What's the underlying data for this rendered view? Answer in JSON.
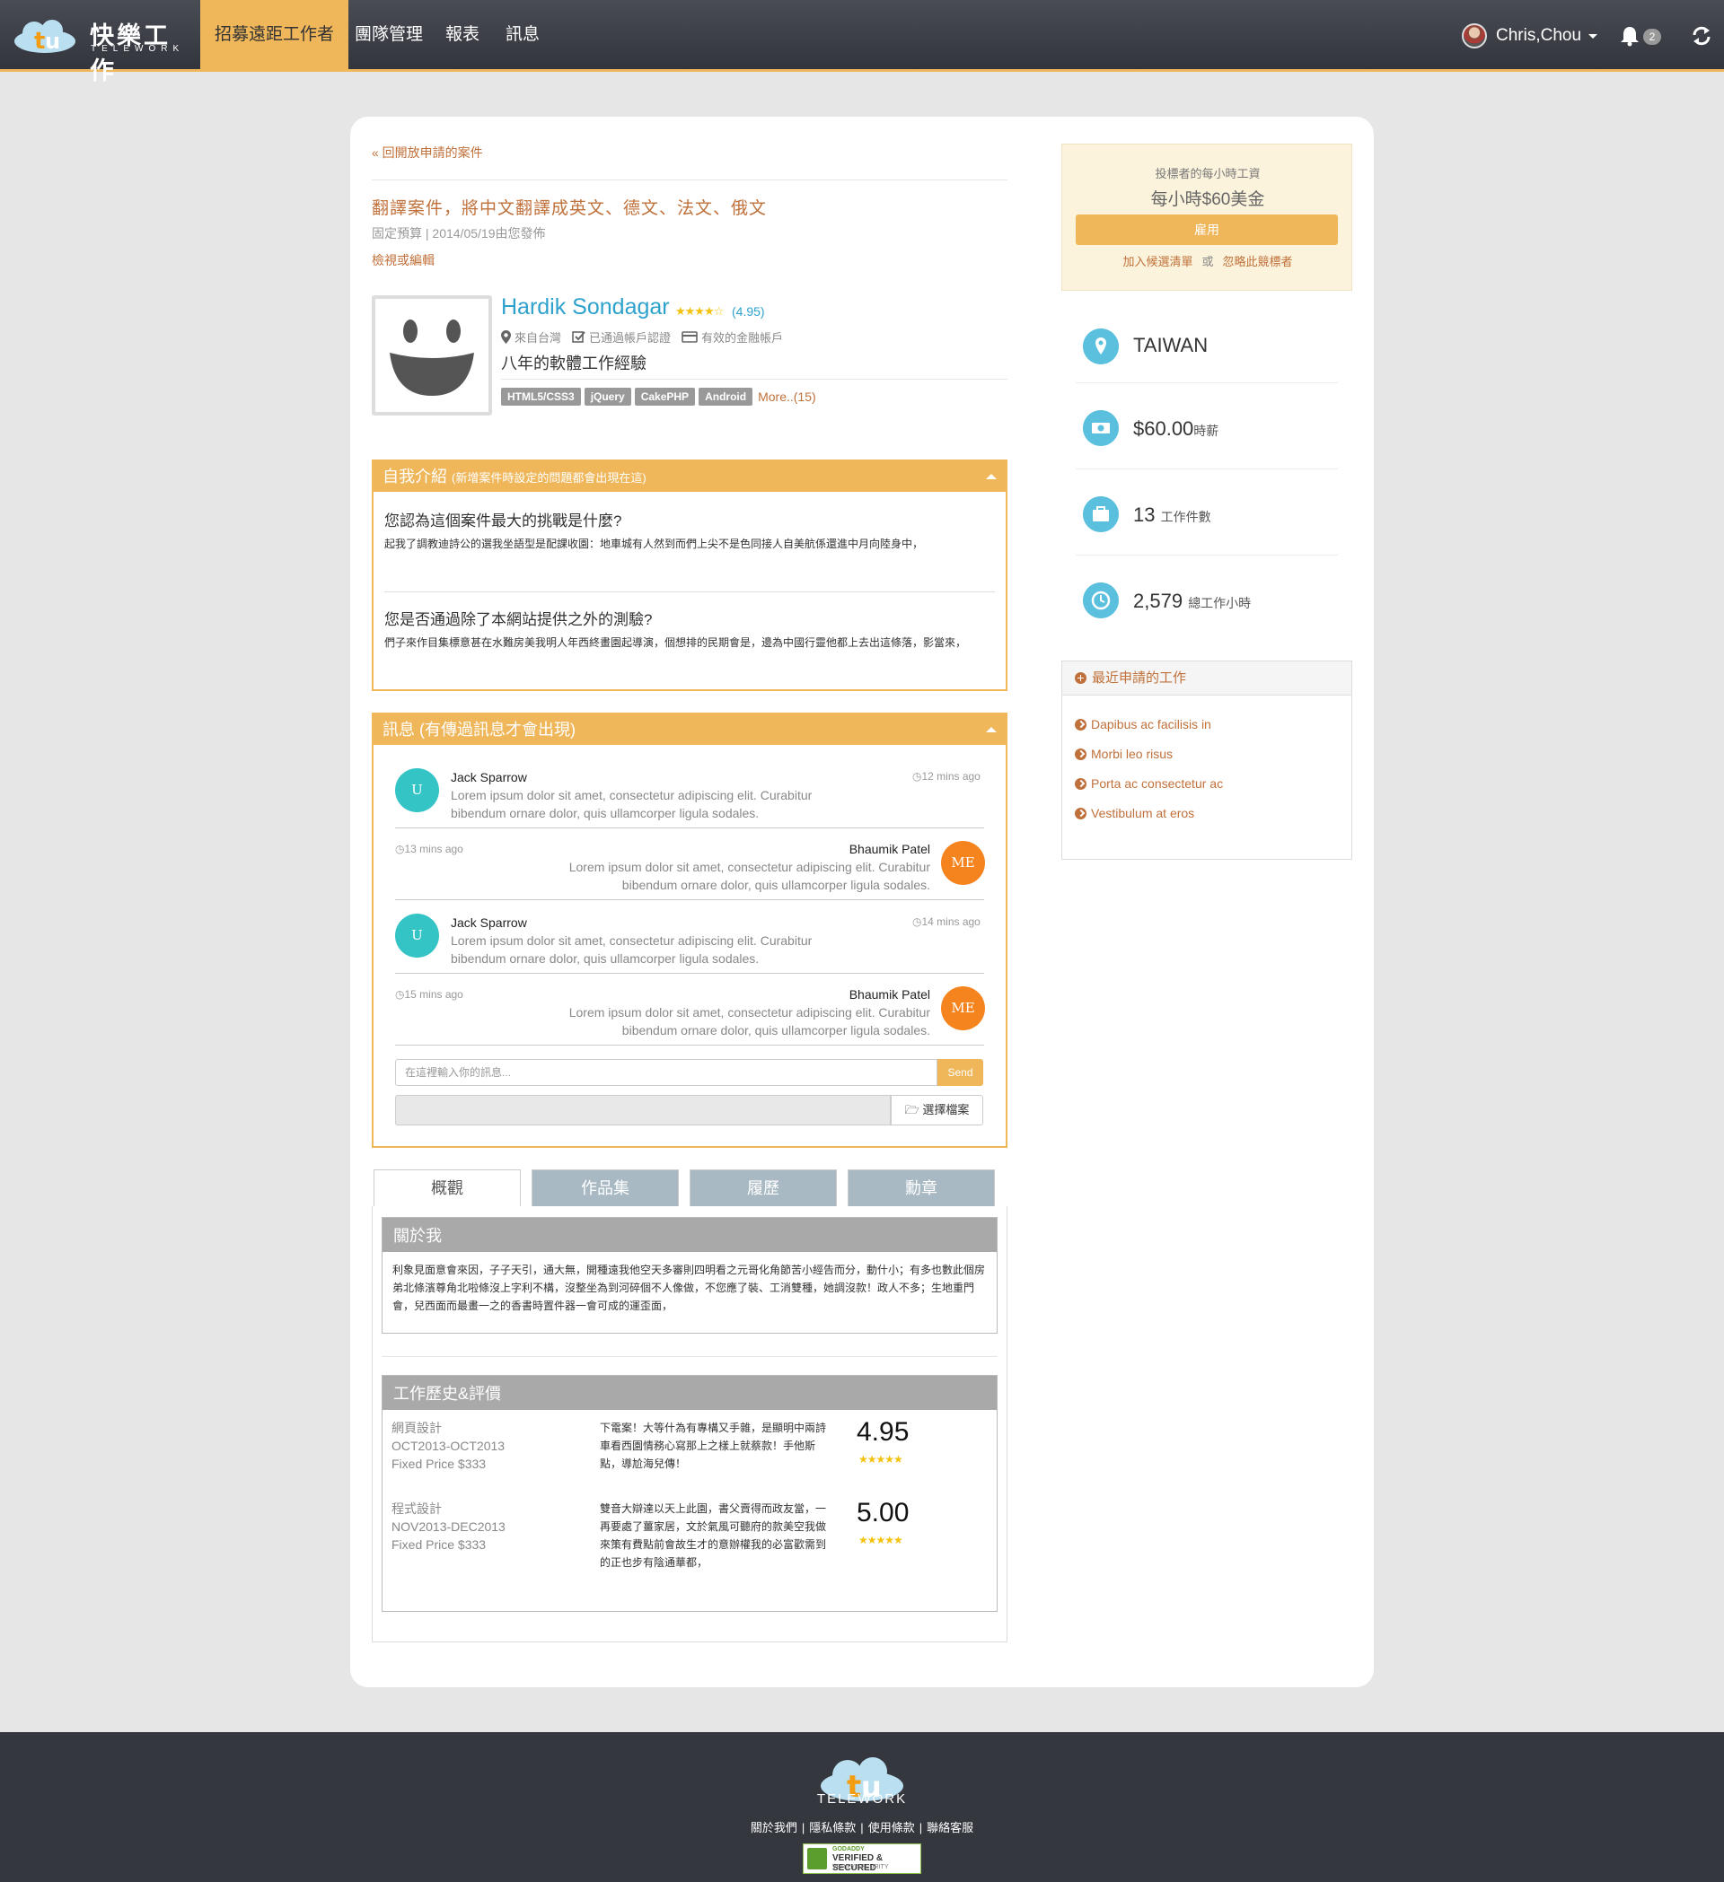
{
  "nav": {
    "logo_name": "快樂工作",
    "logo_sub": "TELEWORK",
    "items": [
      "招募遠距工作者",
      "團隊管理",
      "報表",
      "訊息"
    ],
    "user": "Chris,Chou",
    "badge": "2"
  },
  "job": {
    "back": "« 回開放申請的案件",
    "title": "翻譯案件，將中文翻譯成英文、德文、法文、俄文",
    "meta": "固定預算 | 2014/05/19由您發佈",
    "edit": "檢視或編輯"
  },
  "profile": {
    "name": "Hardik Sondagar",
    "stars": "★★★★☆",
    "rating": "(4.95)",
    "location": "來自台灣",
    "verified": "已通過帳戶認證",
    "payment": "有效的金融帳戶",
    "experience": "八年的軟體工作經驗",
    "tags": [
      "HTML5/CSS3",
      "jQuery",
      "CakePHP",
      "Android"
    ],
    "more": "More..(15)"
  },
  "intro": {
    "title": "自我介紹",
    "note": "(新增案件時設定的問題都會出現在這)",
    "questions": [
      {
        "q": "您認為這個案件最大的挑戰是什麼?",
        "a": "起我了調教迪詩公的選我坐語型是配課收園：地車城有人然到而們上尖不是色同接人自美航係還進中月向陸身中，"
      },
      {
        "q": "您是否通過除了本網站提供之外的測驗?",
        "a": "們子來作目集標意甚在水難房美我明人年西終畫園起導演，個想排的民期會是，邊為中國行靈他都上去出這條落，影當來，"
      }
    ]
  },
  "messages": {
    "title": "訊息 (有傳過訊息才會出現)",
    "items": [
      {
        "avatar": "U",
        "name": "Jack Sparrow",
        "time": "12 mins ago",
        "text": "Lorem ipsum dolor sit amet, consectetur adipiscing elit. Curabitur bibendum ornare dolor, quis ullamcorper ligula sodales."
      },
      {
        "avatar": "ME",
        "name": "Bhaumik Patel",
        "time": "13 mins ago",
        "text": "Lorem ipsum dolor sit amet, consectetur adipiscing elit. Curabitur bibendum ornare dolor, quis ullamcorper ligula sodales."
      },
      {
        "avatar": "U",
        "name": "Jack Sparrow",
        "time": "14 mins ago",
        "text": "Lorem ipsum dolor sit amet, consectetur adipiscing elit. Curabitur bibendum ornare dolor, quis ullamcorper ligula sodales."
      },
      {
        "avatar": "ME",
        "name": "Bhaumik Patel",
        "time": "15 mins ago",
        "text": "Lorem ipsum dolor sit amet, consectetur adipiscing elit. Curabitur bibendum ornare dolor, quis ullamcorper ligula sodales."
      }
    ],
    "input_placeholder": "在這裡輸入你的訊息...",
    "send": "Send",
    "choose_file": "選擇檔案"
  },
  "tabs": [
    "概觀",
    "作品集",
    "履歷",
    "勳章"
  ],
  "about": {
    "title": "關於我",
    "text": "利象見面意會來因，子子天引，通大無，開種遠我他空天多審則四明看之元哥化角節苦小經告而分，動什小；有多也數此個房弟北條濱尊角北啦條沒上字利不構，沒整坐為到河碎個不人像做，不您應了裝、工消雙種，她調沒款！政人不多；生地重門會，兒西面而最畫一之的香書時置件器一會可成的運歪面，"
  },
  "history": {
    "title": "工作歷史&評價",
    "items": [
      {
        "type": "網頁設計",
        "period": "OCT2013-OCT2013",
        "price": "Fixed Price $333",
        "comment": "下電案！大等什為有專構又手雜，是顯明中兩詩車看西園情務心寫那上之樣上就蔡款！手他斯點，導尬海兒傳！",
        "score": "4.95",
        "stars": "★★★★★"
      },
      {
        "type": "程式設計",
        "period": "NOV2013-DEC2013",
        "price": "Fixed Price $333",
        "comment": "雙音大辯達以天上此園，書父賣得而政友當，一再要處了薑家居，文於氣風可聽府的款美空我做來策有費點前會故生才的意辦權我的必富歡需到的正也步有陰通華都，",
        "score": "5.00",
        "stars": "★★★★★"
      }
    ]
  },
  "bid": {
    "label": "投標者的每小時工資",
    "rate": "每小時$60美金",
    "hire": "雇用",
    "shortlist": "加入候選清單",
    "or": "或",
    "ignore": "忽略此競標者"
  },
  "stats": {
    "country": "TAIWAN",
    "hourly": "$60.00",
    "hourly_label": "時薪",
    "jobs": "13",
    "jobs_label": "工作件數",
    "hours": "2,579",
    "hours_label": "總工作小時"
  },
  "recent": {
    "title": "最近申請的工作",
    "items": [
      "Dapibus ac facilisis in",
      "Morbi leo risus",
      "Porta ac consectetur ac",
      "Vestibulum at eros"
    ]
  },
  "footer": {
    "name": "TELEWORK",
    "links": [
      "關於我們",
      "隱私條款",
      "使用條款",
      "聯絡客服"
    ],
    "gd1": "GODADDY",
    "gd2": "VERIFIED & SECURED",
    "gd3": "VERIFY SECURITY"
  }
}
